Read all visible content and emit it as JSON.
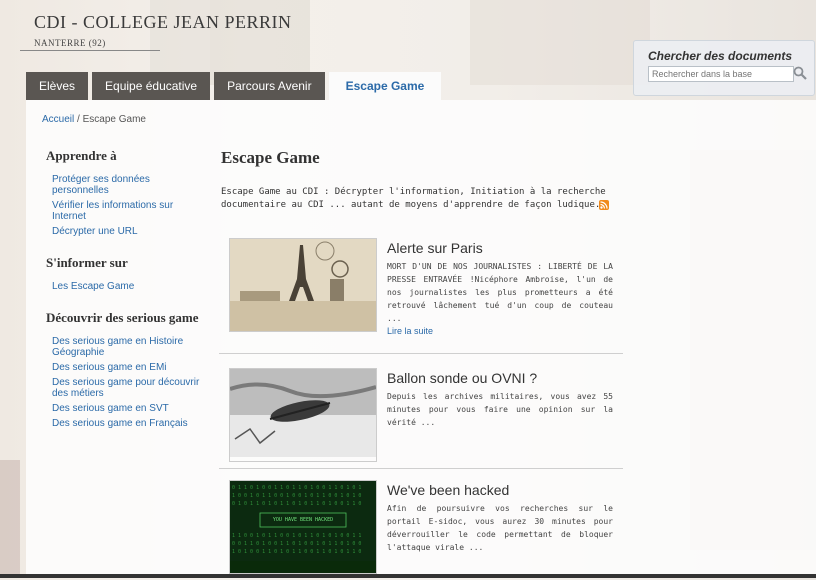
{
  "site": {
    "title": "CDI - COLLEGE JEAN PERRIN",
    "subtitle": "NANTERRE (92)"
  },
  "tabs": [
    {
      "label": "Elèves"
    },
    {
      "label": "Equipe éducative"
    },
    {
      "label": "Parcours Avenir"
    },
    {
      "label": "Escape Game"
    }
  ],
  "search": {
    "title": "Chercher des documents",
    "placeholder": "Rechercher dans la base",
    "icon": "magnifier-icon"
  },
  "breadcrumb": {
    "home": "Accueil",
    "separator": "/",
    "current": "Escape Game"
  },
  "sidebar": {
    "sections": [
      {
        "heading": "Apprendre à",
        "items": [
          "Protéger ses données personnelles",
          "Vérifier les informations sur Internet",
          "Décrypter une URL"
        ]
      },
      {
        "heading": "S'informer sur",
        "items": [
          "Les Escape Game"
        ]
      },
      {
        "heading": "Découvrir des serious game",
        "items": [
          "Des serious game en Histoire Géographie",
          "Des serious game en EMi",
          "Des serious game pour découvrir des métiers",
          "Des serious game en SVT",
          "Des serious game en Français"
        ]
      }
    ]
  },
  "main": {
    "title": "Escape Game",
    "intro": "Escape Game au CDI : Décrypter l'information, Initiation à la recherche documentaire au CDI ... autant de moyens d'apprendre de façon ludique.",
    "rss_icon": "rss-icon",
    "articles": [
      {
        "title": "Alerte sur Paris",
        "text": "MORT D'UN DE NOS JOURNALISTES : LIBERTÉ DE LA PRESSE ENTRAVÉE !Nicéphore Ambroise, l'un de nos journalistes les plus prometteurs a été retrouvé lâchement tué d'un coup de couteau ...",
        "more": "Lire la suite"
      },
      {
        "title": "Ballon sonde ou OVNI ?",
        "text": "Depuis les archives militaires, vous avez 55 minutes pour vous faire une opinion sur la vérité ...",
        "more": ""
      },
      {
        "title": "We've been hacked",
        "text": "Afin de poursuivre vos recherches sur le portail E-sidoc, vous aurez 30 minutes pour déverrouiller le code permettant de bloquer l'attaque virale ...",
        "more": "",
        "thumb_text": "YOU HAVE BEEN HACKED"
      }
    ]
  },
  "colors": {
    "link": "#2b6aa8",
    "tab_bg": "#5a5652",
    "rss": "#f08a1c"
  }
}
